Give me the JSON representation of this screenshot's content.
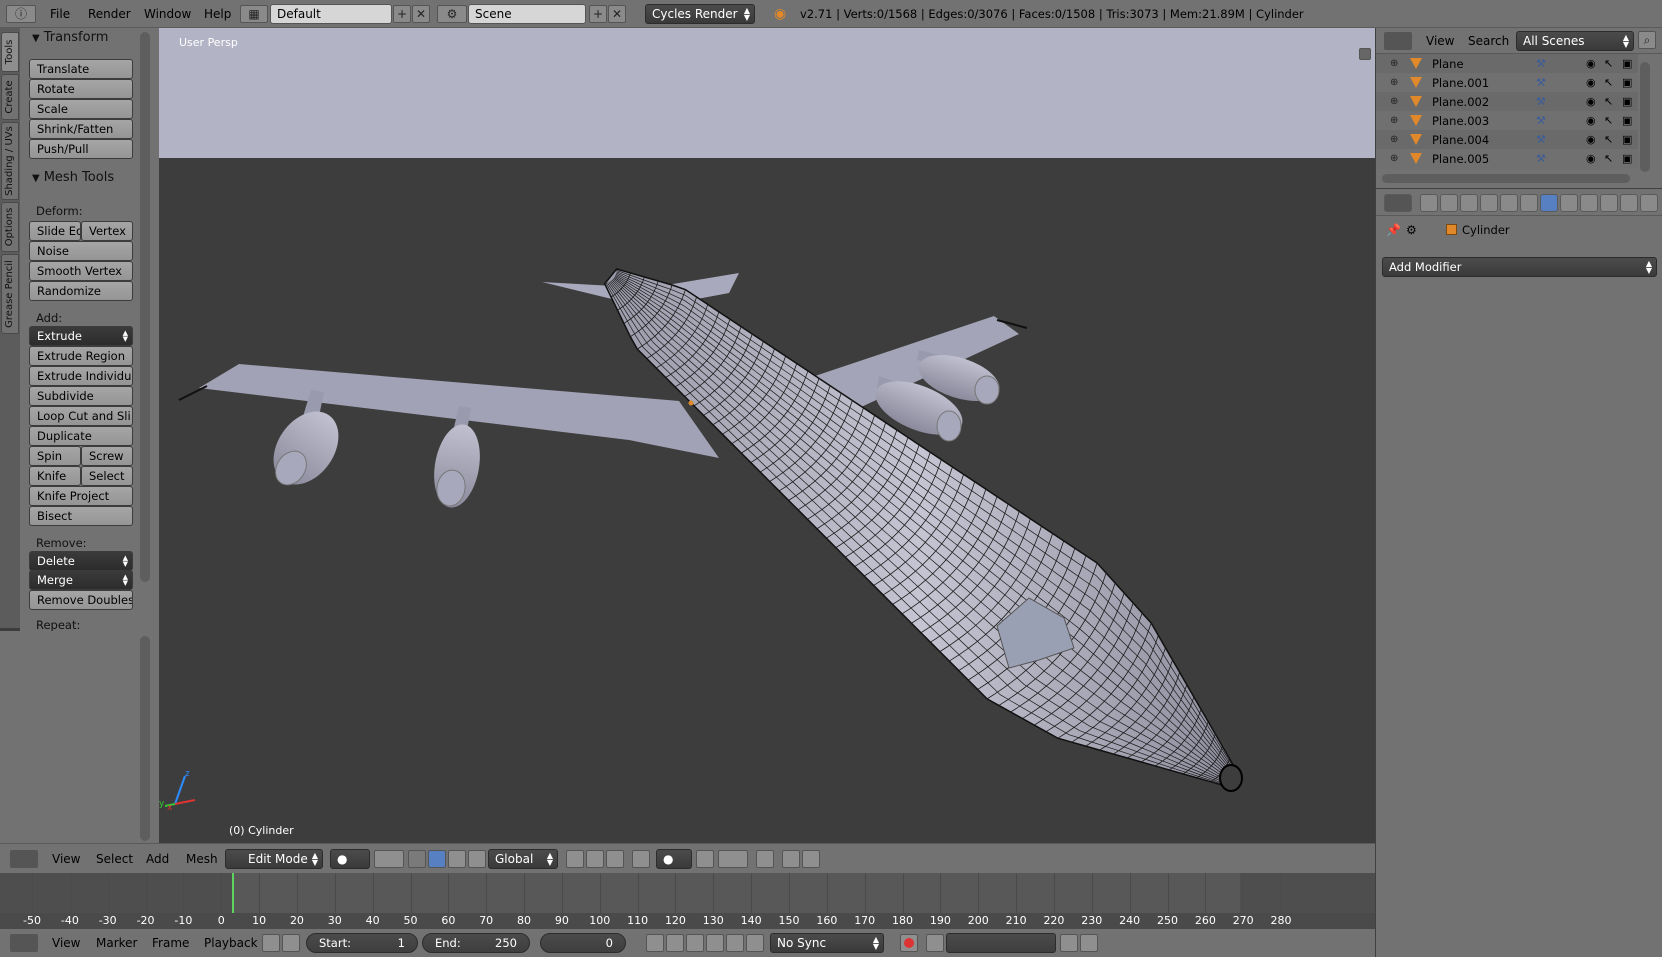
{
  "topbar": {
    "menus": [
      "File",
      "Render",
      "Window",
      "Help"
    ],
    "screen_layout": "Default",
    "scene": "Scene",
    "render_engine": "Cycles Render",
    "stats": "v2.71 | Verts:0/1568 | Edges:0/3076 | Faces:0/1508 | Tris:3073 | Mem:21.89M | Cylinder"
  },
  "left_tabs": [
    "Tools",
    "Create",
    "Shading / UVs",
    "Options",
    "Grease Pencil"
  ],
  "toolshelf": {
    "transform_header": "Transform",
    "transform_buttons": [
      "Translate",
      "Rotate",
      "Scale",
      "Shrink/Fatten",
      "Push/Pull"
    ],
    "mesh_tools_header": "Mesh Tools",
    "deform_label": "Deform:",
    "deform_row": [
      "Slide Ed",
      "Vertex"
    ],
    "deform_buttons": [
      "Noise",
      "Smooth Vertex",
      "Randomize"
    ],
    "add_label": "Add:",
    "extrude": "Extrude",
    "add_buttons": [
      "Extrude Region",
      "Extrude Individual",
      "Subdivide",
      "Loop Cut and Sli...",
      "Duplicate"
    ],
    "spin_row": [
      "Spin",
      "Screw"
    ],
    "knife_row": [
      "Knife",
      "Select"
    ],
    "add_buttons2": [
      "Knife Project",
      "Bisect"
    ],
    "remove_label": "Remove:",
    "delete": "Delete",
    "merge": "Merge",
    "remove_doubles": "Remove Doubles",
    "repeat_label": "Repeat:"
  },
  "viewport": {
    "persp_label": "User Persp",
    "object_label": "(0) Cylinder",
    "axis_labels": [
      "z",
      "y",
      "x"
    ]
  },
  "v3d_header": {
    "menus": [
      "View",
      "Select",
      "Add",
      "Mesh"
    ],
    "mode": "Edit Mode",
    "orientation": "Global"
  },
  "timeline": {
    "ticks": [
      -50,
      -40,
      -30,
      -20,
      -10,
      0,
      10,
      20,
      30,
      40,
      50,
      60,
      70,
      80,
      90,
      100,
      110,
      120,
      130,
      140,
      150,
      160,
      170,
      180,
      190,
      200,
      210,
      220,
      230,
      240,
      250,
      260,
      270,
      280
    ],
    "current_frame": 0
  },
  "tl_header": {
    "menus": [
      "View",
      "Marker",
      "Frame",
      "Playback"
    ],
    "start_label": "Start:",
    "start_value": "1",
    "end_label": "End:",
    "end_value": "250",
    "current_value": "0",
    "sync": "No Sync"
  },
  "outliner": {
    "menus": [
      "View",
      "Search"
    ],
    "scenes": "All Scenes",
    "rows": [
      "Plane",
      "Plane.001",
      "Plane.002",
      "Plane.003",
      "Plane.004",
      "Plane.005"
    ]
  },
  "properties": {
    "object_name": "Cylinder",
    "add_modifier": "Add Modifier"
  },
  "colors": {
    "sky": "#b3b3c6",
    "viewport_bg": "#3d3d3d",
    "panel": "#727272",
    "accent_blue": "#5680c2",
    "object_orange": "#e0882a",
    "playhead_green": "#5fd35f"
  }
}
